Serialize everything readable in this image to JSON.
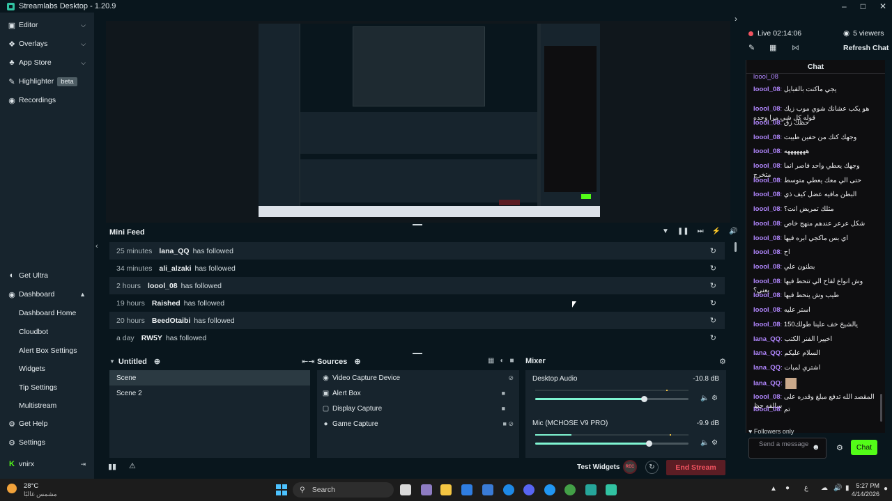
{
  "window": {
    "title": "Streamlabs Desktop - 1.20.9"
  },
  "sidebar": {
    "top_items": [
      {
        "label": "Editor",
        "icon": "editor-icon"
      },
      {
        "label": "Overlays",
        "icon": "overlays-icon"
      },
      {
        "label": "App Store",
        "icon": "store-icon"
      },
      {
        "label": "Highlighter",
        "icon": "highlighter-icon",
        "badge": "beta"
      },
      {
        "label": "Recordings",
        "icon": "recordings-icon"
      }
    ],
    "get_ultra": "Get Ultra",
    "dashboard": "Dashboard",
    "dashboard_items": [
      "Dashboard Home",
      "Cloudbot",
      "Alert Box Settings",
      "Widgets",
      "Tip Settings",
      "Multistream"
    ],
    "get_help": "Get Help",
    "settings": "Settings",
    "user": "vnirx"
  },
  "mini_feed": {
    "title": "Mini Feed",
    "rows": [
      {
        "time": "25 minutes",
        "user": "lana_QQ",
        "action": "has followed"
      },
      {
        "time": "34 minutes",
        "user": "ali_alzaki",
        "action": "has followed"
      },
      {
        "time": "2 hours",
        "user": "loool_08",
        "action": "has followed"
      },
      {
        "time": "19 hours",
        "user": "Raished",
        "action": "has followed"
      },
      {
        "time": "20 hours",
        "user": "BeedOtaibi",
        "action": "has followed"
      },
      {
        "time": "a day",
        "user": "RW5Y",
        "action": "has followed"
      }
    ]
  },
  "scenes": {
    "title": "Untitled",
    "items": [
      "Scene",
      "Scene 2"
    ]
  },
  "sources": {
    "title": "Sources",
    "items": [
      "Video Capture Device",
      "Alert Box",
      "Display Capture",
      "Game Capture"
    ]
  },
  "mixer": {
    "title": "Mixer",
    "channels": [
      {
        "name": "Desktop Audio",
        "level": "-10.8 dB",
        "volume": 0.71
      },
      {
        "name": "Mic (MCHOSE V9 PRO)",
        "level": "-9.9 dB",
        "volume": 0.74
      }
    ]
  },
  "footer": {
    "test_widgets": "Test Widgets",
    "rec": "REC",
    "end_stream": "End Stream"
  },
  "live": {
    "status": "Live",
    "time": "02:14:06",
    "viewers": "5 viewers",
    "refresh": "Refresh Chat"
  },
  "chat": {
    "title": "Chat",
    "messages": [
      {
        "user": "loool_08",
        "text": "يجي ماكنت بالقبايل"
      },
      {
        "user": "loool_08",
        "text": "هو يكب عشانك شوي موب زيك قوله كل شي مرا وحده"
      },
      {
        "user": "loool_08",
        "text": "حظك زق"
      },
      {
        "user": "loool_08",
        "text": "وجهك كنك من حفين طيبت"
      },
      {
        "user": "loool_08",
        "text": "هههههههه"
      },
      {
        "user": "loool_08",
        "text": "وجهك يعطي واحد فاصر انما متخرج"
      },
      {
        "user": "loool_08",
        "text": "حتى الي معك يعطي متوسط"
      },
      {
        "user": "loool_08",
        "text": "البطن مافيه عضل كيف ذي"
      },
      {
        "user": "loool_08",
        "text": "مثلك تمريض انت؟"
      },
      {
        "user": "loool_08",
        "text": "شكل عرعر عندهم منهج خاص"
      },
      {
        "user": "loool_08",
        "text": "اي بس ماكجي ابره فيها"
      },
      {
        "user": "loool_08",
        "text": "اح"
      },
      {
        "user": "loool_08",
        "text": "بطنون علي"
      },
      {
        "user": "loool_08",
        "text": "وش انواع لقاح الي تنحط فيها يعني؟"
      },
      {
        "user": "loool_08",
        "text": "طيب وش ينحط فيها"
      },
      {
        "user": "loool_08",
        "text": "استر عليه"
      },
      {
        "user": "loool_08",
        "text": "يالشيخ خف علينا طولك150"
      },
      {
        "user": "lana_QQ",
        "text": "اخييرا الفنر الكتب"
      },
      {
        "user": "lana_QQ",
        "text": "السلام عليكم"
      },
      {
        "user": "lana_QQ",
        "text": "اشتري لمبات"
      },
      {
        "user": "lana_QQ",
        "text": ""
      },
      {
        "user": "loool_08",
        "text": "المقصد الله تدفع مبلغ وقدره على سالفه حظ"
      },
      {
        "user": "loool_08",
        "text": "تم"
      }
    ],
    "followers_only": "Followers only",
    "input_placeholder": "Send a message",
    "send_button": "Chat"
  },
  "taskbar": {
    "weather_temp": "28°C",
    "weather_desc": "مشمس غالبًا",
    "search": "Search",
    "lang": "ع",
    "time": "5:27 PM",
    "date": "4/14/2026"
  },
  "colors": {
    "accent": "#80f5d2",
    "live": "#f15360",
    "chat_user": "#b287ff",
    "kick": "#53fc18"
  }
}
